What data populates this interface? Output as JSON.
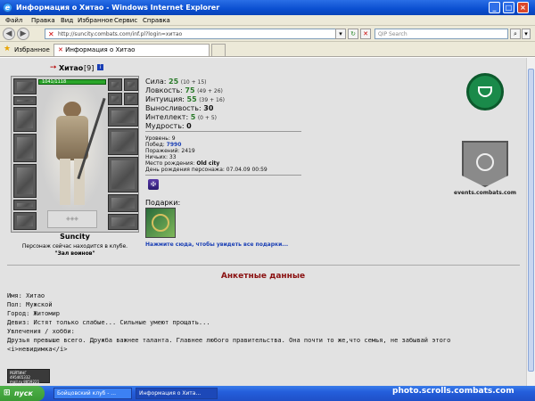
{
  "window": {
    "title": "Информация о Хитао - Windows Internet Explorer"
  },
  "menu": [
    "Файл",
    "Правка",
    "Вид",
    "Избранное",
    "Сервис",
    "Справка"
  ],
  "address": {
    "url": "http://suncity.combats.com/inf.pl?login=хитао",
    "search_placeholder": "QIP Search"
  },
  "tabs": {
    "favorites_label": "Избранное",
    "active_tab": "Информация о Хитао"
  },
  "character": {
    "name": "Хитао",
    "level": "[9]",
    "hp": "1041/1118",
    "city": "Suncity",
    "location_text": "Персонаж сейчас находится в клубе.",
    "location_place": "\"Зал воинов\""
  },
  "stats": [
    {
      "label": "Сила:",
      "value": "25",
      "extra": "(10 + 15)",
      "green": true
    },
    {
      "label": "Ловкость:",
      "value": "75",
      "extra": "(49 + 26)",
      "green": true
    },
    {
      "label": "Интуиция:",
      "value": "55",
      "extra": "(39 + 16)",
      "green": true
    },
    {
      "label": "Выносливость:",
      "value": "30",
      "extra": "",
      "green": false
    },
    {
      "label": "Интеллект:",
      "value": "5",
      "extra": "(0 + 5)",
      "green": true
    },
    {
      "label": "Мудрость:",
      "value": "0",
      "extra": "",
      "green": false
    }
  ],
  "info": {
    "level": "Уровень: 9",
    "wins_label": "Побед:",
    "wins": "7990",
    "losses": "Поражений: 2419",
    "draws": "Ничьих: 33",
    "birthplace_label": "Место рождения:",
    "birthplace": "Old city",
    "birthday": "День рождения персонажа: 07.04.09 00:59"
  },
  "gifts": {
    "label": "Подарки:",
    "link": "Нажмите сюда, чтобы увидеть все подарки..."
  },
  "right": {
    "events_label": "events.combats.com"
  },
  "profile": {
    "header": "Анкетные данные",
    "lines": [
      "Имя: Хитао",
      "Пол: Мужской",
      "Город: Житомир",
      "Девиз: Истят только слабые... Сильные умеют прощать...",
      "Увлечения / хобби:",
      "Друзья превыше всего. Дружба важнее таланта. Главнее любого правительства. Она почти то же,что семья, не забывай этого",
      "<i>невидимка</i>"
    ]
  },
  "counter": {
    "line1": "РЕЙТИНГ 495465332",
    "line2": "mail.ru 8859221",
    "line3": "98021"
  },
  "taskbar": {
    "start_label": "пуск",
    "items": [
      "Бойцовский клуб - ...",
      "Информация о Хита..."
    ]
  },
  "watermark": "photo.scrolls.combats.com"
}
